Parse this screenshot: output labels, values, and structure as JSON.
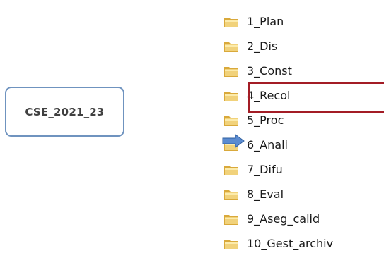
{
  "root_node": {
    "label": "CSE_2021_23"
  },
  "folders": [
    {
      "label": "1_Plan"
    },
    {
      "label": "2_Dis"
    },
    {
      "label": "3_Const"
    },
    {
      "label": "4_Recol"
    },
    {
      "label": "5_Proc"
    },
    {
      "label": "6_Anali"
    },
    {
      "label": "7_Difu"
    },
    {
      "label": "8_Eval"
    },
    {
      "label": "9_Aseg_calid"
    },
    {
      "label": "10_Gest_archiv"
    }
  ],
  "highlighted_folder": "4_Recol",
  "pointer_folder": "6_Anali",
  "colors": {
    "box_border": "#6f93bf",
    "highlight_border": "#a31c25",
    "arrow_fill": "#5b8bd0",
    "folder_yellow": "#e8c05a"
  },
  "icons": {
    "folder": "folder-icon",
    "arrow": "right-arrow-icon"
  }
}
